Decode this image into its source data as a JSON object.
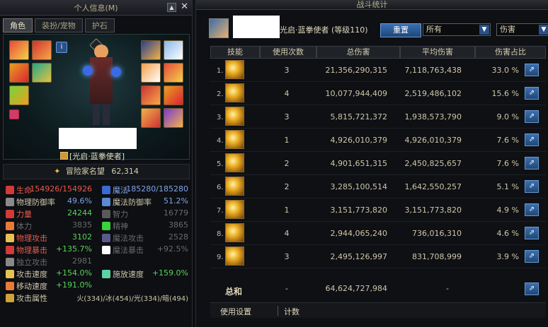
{
  "left": {
    "title": "个人信息(M)",
    "tabs": [
      "角色",
      "装扮/宠物",
      "护石"
    ],
    "nameplate": "[光启·蓝拳使者]",
    "fame_label": "冒险家名望",
    "fame_value": "62,314",
    "stats": [
      {
        "l": "生命",
        "lv": "154926/154926",
        "r": "魔法",
        "rv": "185280/185280"
      },
      {
        "l": "物理防御率",
        "lv": "49.6%",
        "r": "魔法防御率",
        "rv": "51.2%"
      },
      {
        "l": "力量",
        "lv": "24244",
        "r": "智力",
        "rv": "16779"
      },
      {
        "l": "体力",
        "lv": "3835",
        "r": "精神",
        "rv": "3865"
      },
      {
        "l": "物理攻击",
        "lv": "3102",
        "r": "魔法攻击",
        "rv": "2528"
      },
      {
        "l": "物理暴击",
        "lv": "+135.7%",
        "r": "魔法暴击",
        "rv": "+92.5%"
      },
      {
        "l": "独立攻击",
        "lv": "2981",
        "r": "",
        "rv": ""
      },
      {
        "l": "攻击速度",
        "lv": "+154.0%",
        "r": "施放速度",
        "rv": "+159.0%"
      },
      {
        "l": "移动速度",
        "lv": "+191.0%",
        "r": "",
        "rv": ""
      }
    ],
    "attr_label": "攻击属性",
    "attr_value": "火(334)/冰(454)/光(334)/暗(494)"
  },
  "right": {
    "title": "战斗统计",
    "class_name": "光启·蓝拳使者 (等级110)",
    "reset_label": "重置",
    "filter1": "所有",
    "filter2": "伤害",
    "headers": [
      "技能",
      "使用次数",
      "总伤害",
      "平均伤害",
      "伤害占比"
    ],
    "rows": [
      {
        "i": "1.",
        "count": "3",
        "total": "21,356,290,315",
        "avg": "7,118,763,438",
        "pct": "33.0 %"
      },
      {
        "i": "2.",
        "count": "4",
        "total": "10,077,944,409",
        "avg": "2,519,486,102",
        "pct": "15.6 %"
      },
      {
        "i": "3.",
        "count": "3",
        "total": "5,815,721,372",
        "avg": "1,938,573,790",
        "pct": "9.0 %"
      },
      {
        "i": "4.",
        "count": "1",
        "total": "4,926,010,379",
        "avg": "4,926,010,379",
        "pct": "7.6 %"
      },
      {
        "i": "5.",
        "count": "2",
        "total": "4,901,651,315",
        "avg": "2,450,825,657",
        "pct": "7.6 %"
      },
      {
        "i": "6.",
        "count": "2",
        "total": "3,285,100,514",
        "avg": "1,642,550,257",
        "pct": "5.1 %"
      },
      {
        "i": "7.",
        "count": "1",
        "total": "3,151,773,820",
        "avg": "3,151,773,820",
        "pct": "4.9 %"
      },
      {
        "i": "8.",
        "count": "4",
        "total": "2,944,065,240",
        "avg": "736,016,310",
        "pct": "4.6 %"
      },
      {
        "i": "9.",
        "count": "3",
        "total": "2,495,126,997",
        "avg": "831,708,999",
        "pct": "3.9 %"
      }
    ],
    "total_label": "总和",
    "total_count": "-",
    "total_damage": "64,624,727,984",
    "total_avg": "-",
    "bottom_a": "使用设置",
    "bottom_b": "计数"
  }
}
